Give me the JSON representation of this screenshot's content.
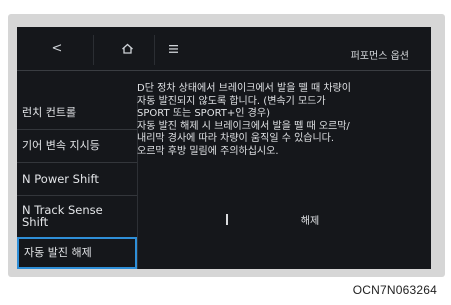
{
  "topbar": {
    "back_icon": "<",
    "page_title": "퍼포먼스 옵션"
  },
  "sidebar": {
    "items": [
      {
        "label": "런치 컨트롤"
      },
      {
        "label": "기어 변속 지시등"
      },
      {
        "label": "N Power Shift"
      },
      {
        "label": "N Track Sense Shift"
      },
      {
        "label": "자동 발진 해제"
      }
    ]
  },
  "content": {
    "lines": [
      "D단 정차 상태에서 브레이크에서 발을 뗄 때 차량이",
      "자동 발진되지 않도록 합니다. (변속기 모드가",
      "SPORT 또는 SPORT+인 경우)",
      "자동 발진 해제 시 브레이크에서 발을 뗄 때 오르막/",
      "내리막 경사에 따라 차량이 움직일 수 있습니다.",
      "오르막 후방 밀림에 주의하십시오."
    ]
  },
  "actions": {
    "release_label": "해제"
  },
  "caption": "OCN7N063264",
  "colors": {
    "screen_bg": "#15171b",
    "selected_border": "#2f8fd8",
    "bezel": "#d6d6d6"
  }
}
